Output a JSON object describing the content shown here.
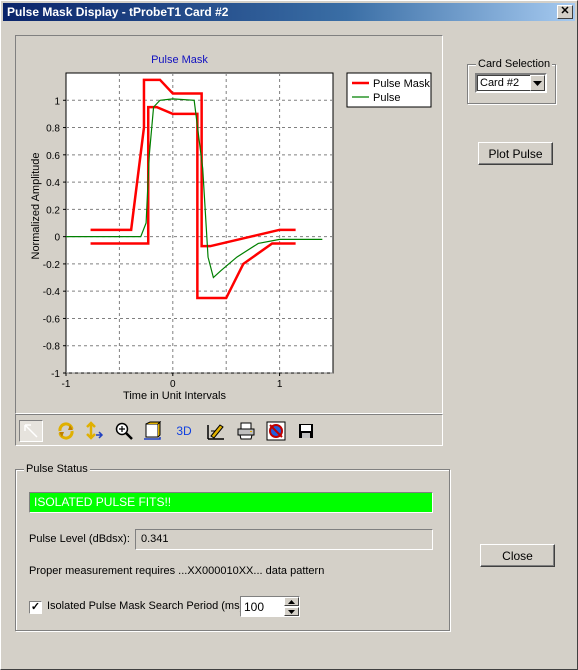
{
  "window": {
    "title": "Pulse Mask Display - tProbeT1 Card #2",
    "close_glyph": "✕"
  },
  "card_selection": {
    "group_label": "Card Selection",
    "selected": "Card #2"
  },
  "plot_button_label": "Plot Pulse",
  "close_button_label": "Close",
  "toolbar": {
    "icons": [
      "pointer-icon",
      "rotate-icon",
      "move-icon",
      "zoom-icon",
      "depth-icon",
      "3d-icon",
      "edit-icon",
      "print-icon",
      "copy-icon",
      "save-icon"
    ],
    "3d_label": "3D"
  },
  "pulse_status": {
    "group_label": "Pulse Status",
    "status_text": "ISOLATED PULSE FITS!!",
    "status_color": "#00ff00",
    "level_label": "Pulse Level (dBdsx):",
    "level_value": "0.341",
    "pattern_note": "Proper measurement requires ...XX000010XX... data pattern",
    "search_checkbox_label": "Isolated Pulse Mask Search Period (ms)",
    "search_checked": true,
    "search_period": "100"
  },
  "chart_data": {
    "type": "line",
    "title": "Pulse Mask",
    "xlabel": "Time in Unit Intervals",
    "ylabel": "Normalized Amplitude",
    "xlim": [
      -1,
      1.5
    ],
    "ylim": [
      -1,
      1.2
    ],
    "x_ticks": [
      -1,
      0,
      1
    ],
    "y_ticks": [
      -1,
      -0.8,
      -0.6,
      -0.4,
      -0.2,
      0,
      0.2,
      0.4,
      0.6,
      0.8,
      1
    ],
    "grid": true,
    "legend_position": "top-right",
    "series": [
      {
        "name": "Pulse Mask",
        "color": "#ff0000",
        "segments": [
          [
            [
              -0.77,
              0.05
            ],
            [
              -0.39,
              0.05
            ],
            [
              -0.27,
              0.8
            ],
            [
              -0.27,
              1.15
            ],
            [
              -0.12,
              1.15
            ],
            [
              0,
              1.05
            ],
            [
              0.27,
              1.05
            ],
            [
              0.27,
              -0.07
            ],
            [
              0.35,
              -0.07
            ],
            [
              1,
              0.05
            ],
            [
              1.15,
              0.05
            ]
          ],
          [
            [
              -0.77,
              -0.05
            ],
            [
              -0.23,
              -0.05
            ],
            [
              -0.23,
              0.95
            ],
            [
              -0.15,
              0.95
            ],
            [
              0,
              0.9
            ],
            [
              0.23,
              0.9
            ],
            [
              0.23,
              -0.45
            ],
            [
              0.5,
              -0.45
            ],
            [
              0.66,
              -0.2
            ],
            [
              0.93,
              -0.05
            ],
            [
              1.15,
              -0.05
            ]
          ]
        ]
      },
      {
        "name": "Pulse",
        "color": "#008000",
        "points": [
          [
            -1,
            0
          ],
          [
            -0.3,
            0
          ],
          [
            -0.25,
            0.1
          ],
          [
            -0.22,
            0.6
          ],
          [
            -0.18,
            0.95
          ],
          [
            -0.12,
            1.0
          ],
          [
            0.0,
            1.01
          ],
          [
            0.2,
            1.0
          ],
          [
            0.28,
            0.5
          ],
          [
            0.33,
            -0.15
          ],
          [
            0.38,
            -0.3
          ],
          [
            0.45,
            -0.25
          ],
          [
            0.6,
            -0.15
          ],
          [
            0.8,
            -0.05
          ],
          [
            1.0,
            -0.02
          ],
          [
            1.4,
            -0.02
          ]
        ]
      }
    ]
  }
}
